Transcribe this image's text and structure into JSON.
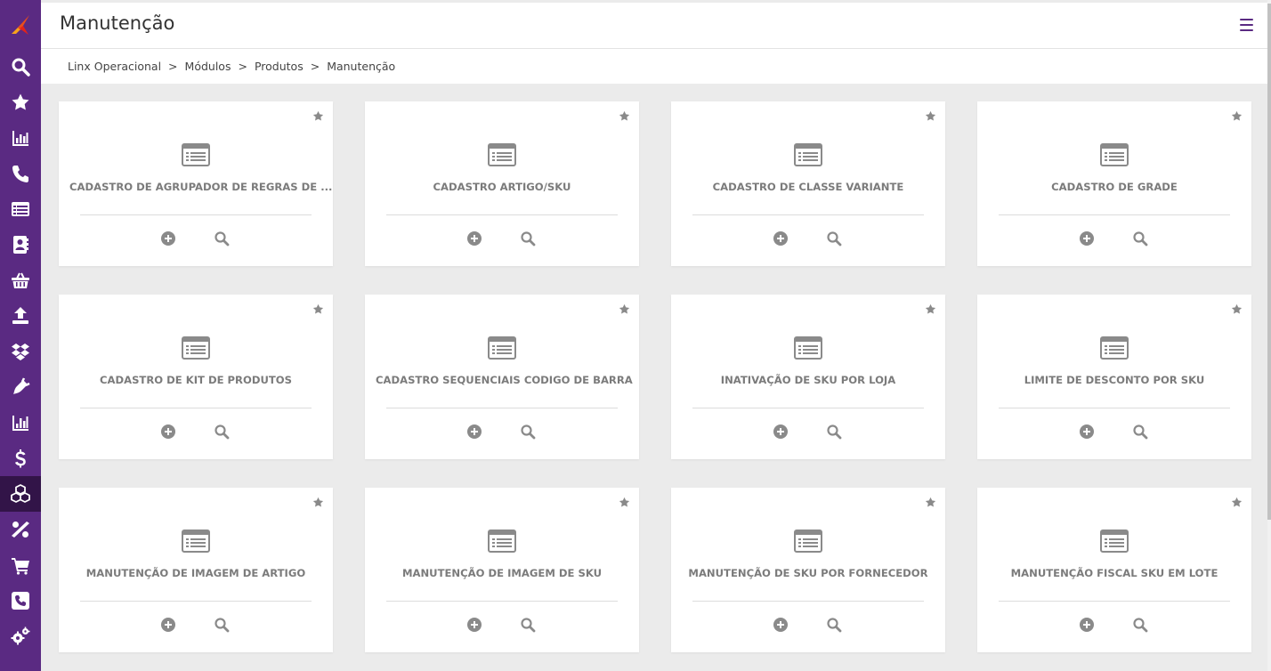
{
  "app": {
    "accent_color": "#5a2a82",
    "logo_name": "linx-logo"
  },
  "sidebar": {
    "items": [
      {
        "icon": "search-icon"
      },
      {
        "icon": "star-icon"
      },
      {
        "icon": "bar-chart-icon"
      },
      {
        "icon": "phone-icon"
      },
      {
        "icon": "list-icon"
      },
      {
        "icon": "contacts-icon"
      },
      {
        "icon": "basket-icon"
      },
      {
        "icon": "upload-icon"
      },
      {
        "icon": "dropbox-icon"
      },
      {
        "icon": "plug-icon"
      },
      {
        "icon": "chart-icon"
      },
      {
        "icon": "dollar-icon"
      },
      {
        "icon": "cubes-icon",
        "active": true
      },
      {
        "icon": "percent-icon"
      },
      {
        "icon": "cart-icon"
      },
      {
        "icon": "phone-square-icon"
      },
      {
        "icon": "cogs-icon"
      }
    ]
  },
  "header": {
    "title": "Manutenção"
  },
  "breadcrumb": {
    "items": [
      "Linx Operacional",
      "Módulos",
      "Produtos",
      "Manutenção"
    ],
    "separator": ">"
  },
  "cards": [
    {
      "title": "CADASTRO DE AGRUPADOR DE REGRAS DE ..."
    },
    {
      "title": "CADASTRO ARTIGO/SKU"
    },
    {
      "title": "CADASTRO DE CLASSE VARIANTE"
    },
    {
      "title": "CADASTRO DE GRADE"
    },
    {
      "title": "CADASTRO DE KIT DE PRODUTOS"
    },
    {
      "title": "CADASTRO SEQUENCIAIS CODIGO DE BARRA"
    },
    {
      "title": "INATIVAÇÃO DE SKU POR LOJA"
    },
    {
      "title": "LIMITE DE DESCONTO POR SKU"
    },
    {
      "title": "MANUTENÇÃO DE IMAGEM DE ARTIGO"
    },
    {
      "title": "MANUTENÇÃO DE IMAGEM DE SKU"
    },
    {
      "title": "MANUTENÇÃO DE SKU POR FORNECEDOR"
    },
    {
      "title": "MANUTENÇÃO FISCAL SKU EM LOTE"
    }
  ]
}
